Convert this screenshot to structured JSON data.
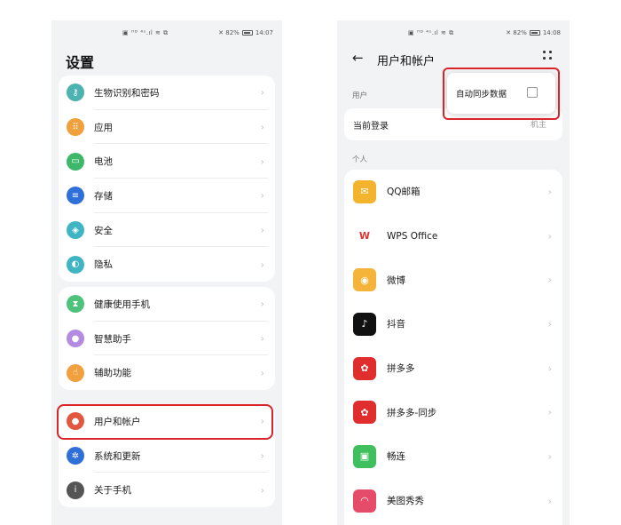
{
  "left_screen": {
    "status": {
      "signal": "▣ ᴴᴰ ⁴ˢ.ıl ≋ ⧉",
      "battery": "✕ 82%",
      "time": "14:07"
    },
    "title": "设置",
    "groups": [
      [
        {
          "label": "生物识别和密码",
          "icon": "key-icon",
          "color": "#4cb3b0"
        },
        {
          "label": "应用",
          "icon": "apps-grid-icon",
          "color": "#f0a03c"
        },
        {
          "label": "电池",
          "icon": "battery-icon",
          "color": "#3db86a"
        },
        {
          "label": "存储",
          "icon": "storage-icon",
          "color": "#2f6fd8"
        },
        {
          "label": "安全",
          "icon": "shield-icon",
          "color": "#3fb5c4"
        },
        {
          "label": "隐私",
          "icon": "privacy-icon",
          "color": "#3fb5c4"
        }
      ],
      [
        {
          "label": "健康使用手机",
          "icon": "hourglass-icon",
          "color": "#4cc27a"
        },
        {
          "label": "智慧助手",
          "icon": "assistant-orb-icon",
          "color": "#b48be0"
        },
        {
          "label": "辅助功能",
          "icon": "hand-icon",
          "color": "#f0a03c"
        }
      ],
      [
        {
          "label": "用户和帐户",
          "icon": "user-icon",
          "color": "#e4573f"
        },
        {
          "label": "系统和更新",
          "icon": "gear-icon",
          "color": "#2f6fd8"
        },
        {
          "label": "关于手机",
          "icon": "info-icon",
          "color": "#555555"
        }
      ]
    ],
    "chevron": "›"
  },
  "right_screen": {
    "status": {
      "signal": "▣ ᴴᴰ ⁴ˢ.ıl ≋ ⧉",
      "battery": "✕ 82%",
      "time": "14:08"
    },
    "back": "←",
    "title": "用户和帐户",
    "section_user": "用户",
    "current_login": {
      "label": "当前登录",
      "value": "机主"
    },
    "section_personal": "个人",
    "popup": {
      "label": "自动同步数据",
      "checked": false
    },
    "apps": [
      {
        "label": "QQ邮箱",
        "icon": "qq-mail-icon",
        "color": "#f3b32c",
        "glyph": "✉"
      },
      {
        "label": "WPS Office",
        "icon": "wps-office-icon",
        "color": "#ffffff",
        "glyph": "W"
      },
      {
        "label": "微博",
        "icon": "weibo-icon",
        "color": "#f4b43a",
        "glyph": "◉"
      },
      {
        "label": "抖音",
        "icon": "douyin-icon",
        "color": "#111111",
        "glyph": "♪"
      },
      {
        "label": "拼多多",
        "icon": "pinduoduo-icon",
        "color": "#e02d2d",
        "glyph": "✿"
      },
      {
        "label": "拼多多-同步",
        "icon": "pinduoduo-sync-icon",
        "color": "#e02d2d",
        "glyph": "✿"
      },
      {
        "label": "畅连",
        "icon": "changlian-icon",
        "color": "#3fbf5e",
        "glyph": "▣"
      },
      {
        "label": "美图秀秀",
        "icon": "meitu-icon",
        "color": "#e64c6a",
        "glyph": "◠"
      }
    ],
    "chevron": "›"
  }
}
